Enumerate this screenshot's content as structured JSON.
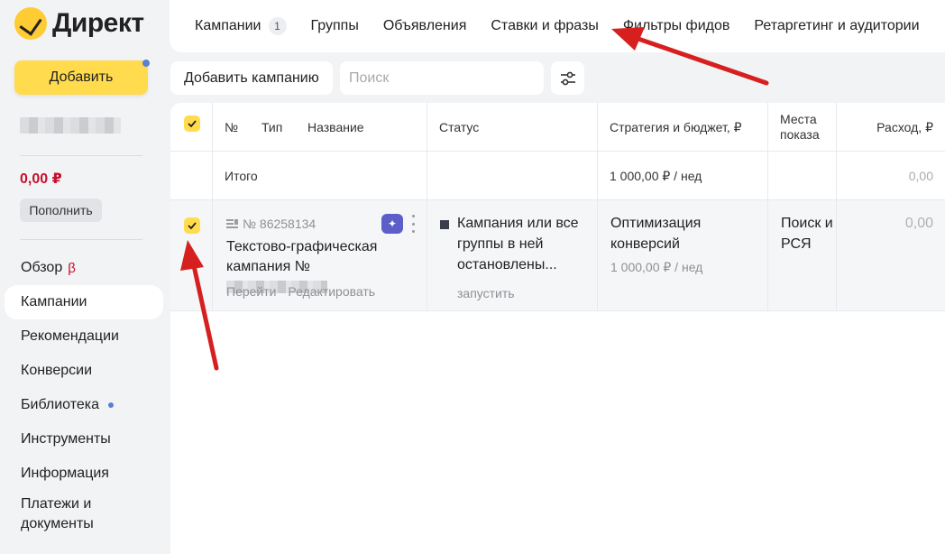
{
  "app": {
    "logo_text": "Директ"
  },
  "sidebar": {
    "add_label": "Добавить",
    "balance": "0,00 ₽",
    "topup_label": "Пополнить",
    "nav": [
      {
        "label": "Обзор",
        "badge": "β"
      },
      {
        "label": "Кампании",
        "active": true
      },
      {
        "label": "Рекомендации"
      },
      {
        "label": "Конверсии"
      },
      {
        "label": "Библиотека",
        "dot": true
      },
      {
        "label": "Инструменты"
      },
      {
        "label": "Информация"
      },
      {
        "label": "Платежи и документы"
      }
    ]
  },
  "tabs": [
    {
      "label": "Кампании",
      "count": "1",
      "active": true
    },
    {
      "label": "Группы"
    },
    {
      "label": "Объявления"
    },
    {
      "label": "Ставки и фразы"
    },
    {
      "label": "Фильтры фидов"
    },
    {
      "label": "Ретаргетинг и аудитории"
    }
  ],
  "toolbar": {
    "add_campaign_label": "Добавить кампанию",
    "search_placeholder": "Поиск"
  },
  "table": {
    "headers": {
      "number": "№",
      "type": "Тип",
      "name": "Название",
      "status": "Статус",
      "strategy": "Стратегия и бюджет, ₽",
      "placement": "Места показа",
      "spend": "Расход, ₽"
    },
    "total": {
      "label": "Итого",
      "budget": "1 000,00 ₽ / нед",
      "spend": "0,00"
    },
    "campaign": {
      "number": "№ 86258134",
      "name": "Текстово-графическая кампания №",
      "link_go": "Перейти",
      "link_edit": "Редактировать",
      "status": "Кампания или все группы в ней остановлены...",
      "status_action": "запустить",
      "strategy": "Оптимизация конверсий",
      "budget": "1 000,00 ₽ / нед",
      "placement": "Поиск и РСЯ",
      "spend": "0,00"
    }
  },
  "colors": {
    "accent_yellow": "#ffdb4d",
    "balance_red": "#c8102e",
    "arrow_red": "#d6201f",
    "ai_badge": "#5b5fc7"
  }
}
